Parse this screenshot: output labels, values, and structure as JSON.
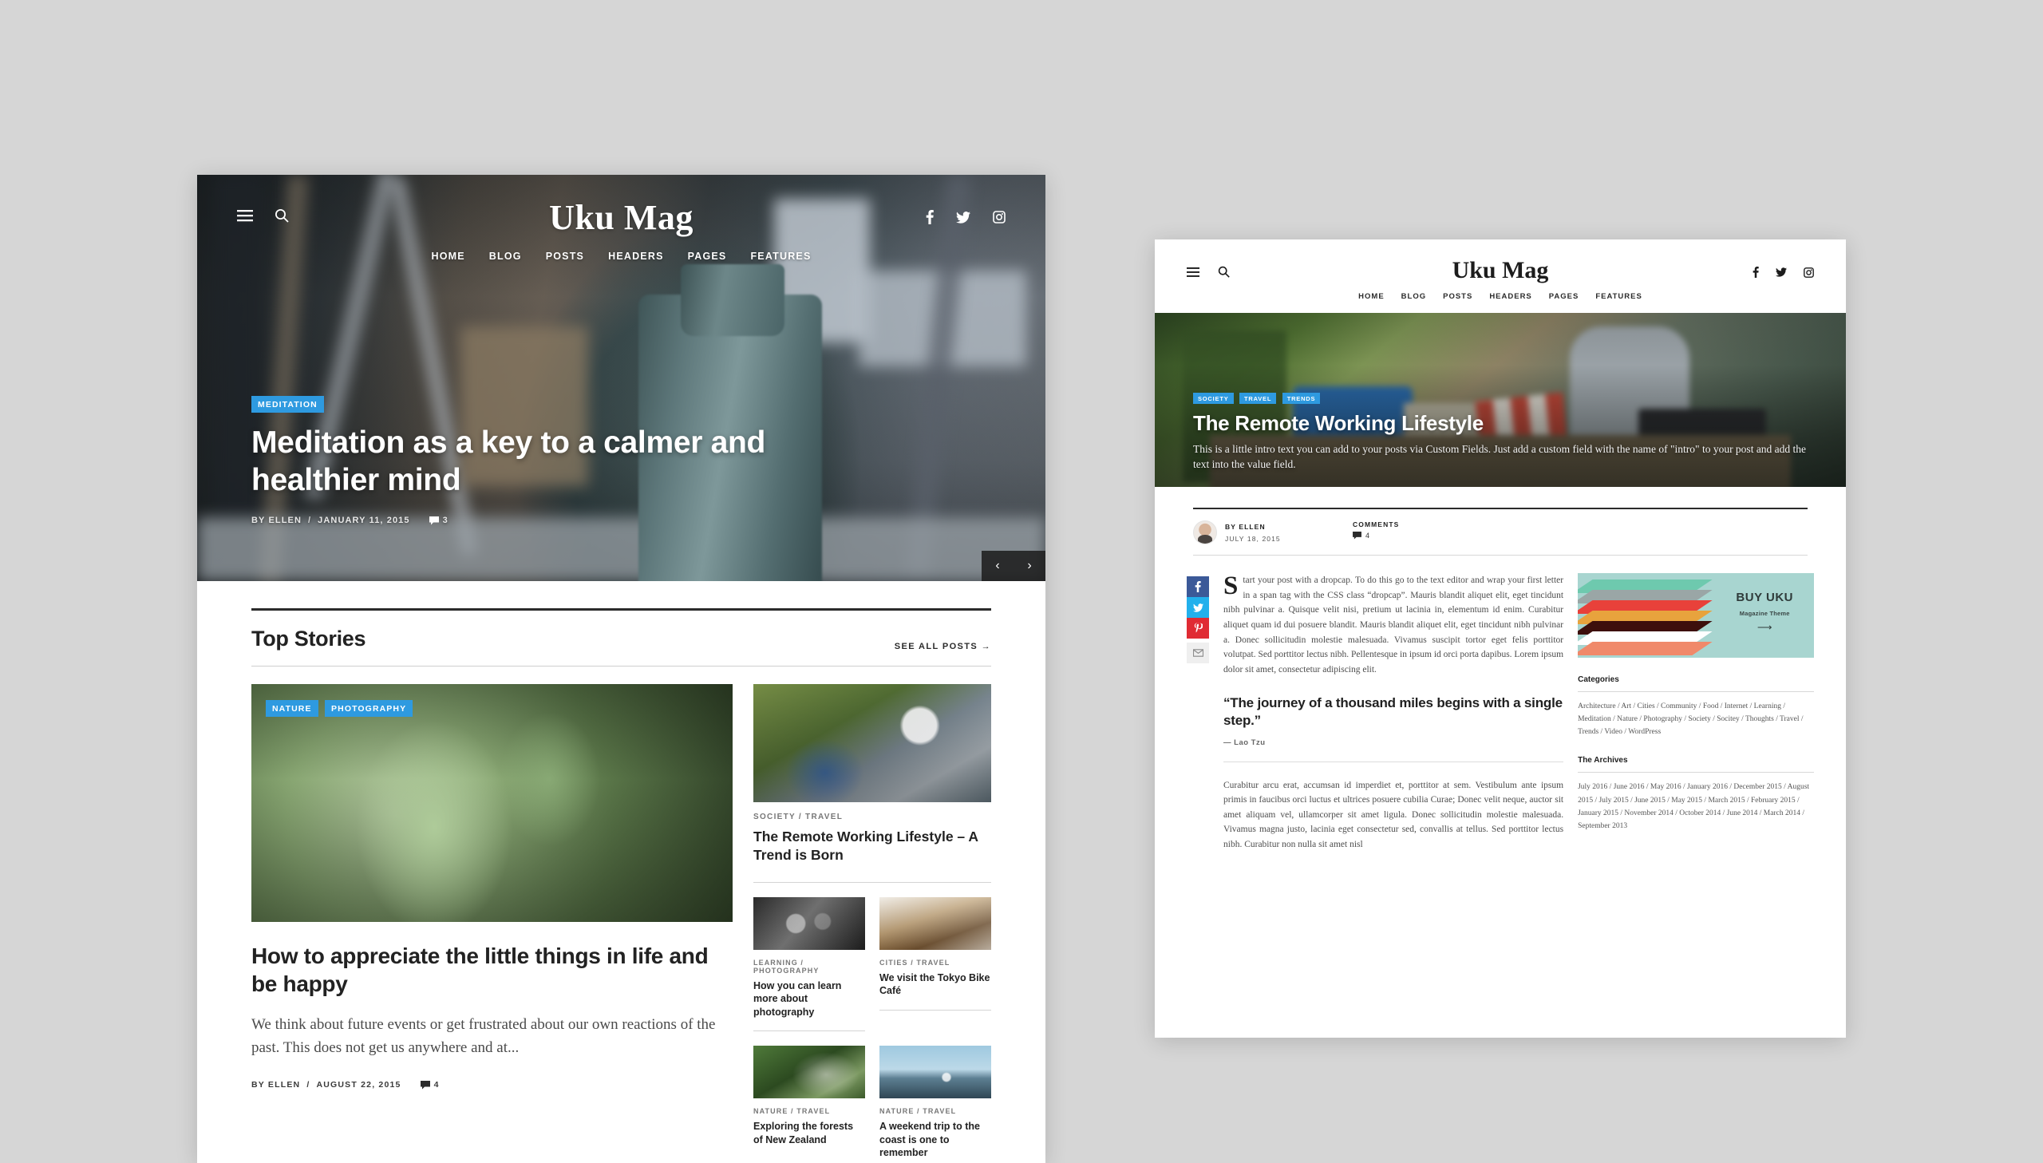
{
  "site": {
    "brand": "Uku Mag",
    "nav": [
      "HOME",
      "BLOG",
      "POSTS",
      "HEADERS",
      "PAGES",
      "FEATURES"
    ],
    "social": [
      "facebook-icon",
      "twitter-icon",
      "instagram-icon"
    ],
    "menu_icon": "hamburger-icon",
    "search_icon": "search-icon"
  },
  "window1": {
    "hero": {
      "badges": [
        "MEDITATION"
      ],
      "title": "Meditation as a key to a calmer and healthier mind",
      "author": "BY ELLEN",
      "separator": "/",
      "date": "JANUARY 11, 2015",
      "comments": "3",
      "prev_label": "‹",
      "next_label": "›"
    },
    "top_stories": {
      "heading": "Top Stories",
      "see_all": "SEE ALL POSTS →",
      "featured": {
        "badges": [
          "NATURE",
          "PHOTOGRAPHY"
        ],
        "title": "How to appreciate the little things in life and be happy",
        "excerpt": "We think about future events or get frustrated about our own reactions of the past. This does not get us anywhere and at...",
        "author": "BY ELLEN",
        "separator": "/",
        "date": "AUGUST 22, 2015",
        "comments": "4"
      },
      "side_featured": {
        "categories": "SOCIETY  /  TRAVEL",
        "title": "The Remote Working Lifestyle – A Trend is Born"
      },
      "mini_posts": [
        {
          "categories": "LEARNING  /  PHOTOGRAPHY",
          "title": "How you can learn more about photography"
        },
        {
          "categories": "CITIES  /  TRAVEL",
          "title": "We visit the Tokyo Bike Café"
        },
        {
          "categories": "NATURE  /  TRAVEL",
          "title": "Exploring the forests of New Zealand"
        },
        {
          "categories": "NATURE  /  TRAVEL",
          "title": "A weekend trip to the coast is one to remember"
        }
      ]
    }
  },
  "window2": {
    "hero": {
      "badges": [
        "SOCIETY",
        "TRAVEL",
        "TRENDS"
      ],
      "title": "The Remote Working Lifestyle",
      "intro": "This is a little intro text you can add to your posts via Custom Fields. Just add a custom field with the name of \"intro\" to your post and add the text into the value field."
    },
    "meta": {
      "author_label": "BY ELLEN",
      "date": "JULY 18, 2015",
      "comments_label": "COMMENTS",
      "comments_count": "4"
    },
    "share": [
      {
        "name": "facebook-share",
        "glyph": "f",
        "color": "#3b5998"
      },
      {
        "name": "twitter-share",
        "glyph": "t",
        "color": "#22b0ec"
      },
      {
        "name": "pinterest-share",
        "glyph": "P",
        "color": "#e02b33"
      },
      {
        "name": "email-share",
        "glyph": "✉",
        "color": "#efefef"
      }
    ],
    "article": {
      "dropcap": "S",
      "paragraph1": "tart your post with a dropcap. To do this go to the text editor and wrap your first letter in a span tag with the CSS class “dropcap”. Mauris blandit aliquet elit, eget tincidunt nibh pulvinar a. Quisque velit nisi, pretium ut lacinia in, elementum id enim. Curabitur aliquet quam id dui posuere blandit. Mauris blandit aliquet elit, eget tincidunt nibh pulvinar a. Donec sollicitudin molestie malesuada. Vivamus suscipit tortor eget felis porttitor volutpat. Sed porttitor lectus nibh. Pellentesque in ipsum id orci porta dapibus. Lorem ipsum dolor sit amet, consectetur adipiscing elit.",
      "quote": "“The journey of a thousand miles begins with a single step.”",
      "quote_author": "— Lao Tzu",
      "paragraph2": "Curabitur arcu erat, accumsan id imperdiet et, porttitor at sem. Vestibulum ante ipsum primis in faucibus orci luctus et ultrices posuere cubilia Curae; Donec velit neque, auctor sit amet aliquam vel, ullamcorper sit amet ligula. Donec sollicitudin molestie malesuada. Vivamus magna justo, lacinia eget consectetur sed, convallis at tellus. Sed porttitor lectus nibh. Curabitur non nulla sit amet nisl"
    },
    "sidebar": {
      "ad": {
        "title": "BUY UKU",
        "subtitle": "Magazine Theme",
        "arrow": "⟶",
        "bg": "#a8d5d0",
        "layer_colors": [
          "#6ec9ae",
          "#9aa6a6",
          "#e8413a",
          "#e8a33d",
          "#3d0f0c",
          "#f0896a",
          "#ffffff"
        ]
      },
      "categories": {
        "heading": "Categories",
        "items": "Architecture / Art / Cities / Community / Food / Internet / Learning / Meditation / Nature / Photography / Society / Socitey / Thoughts / Travel / Trends / Video / WordPress"
      },
      "archives": {
        "heading": "The Archives",
        "items": "July 2016 / June 2016 / May 2016 / January 2016 / December 2015 / August 2015 / July 2015 / June 2015 / May 2015 / March 2015 / February 2015 / January 2015 / November 2014 / October 2014 / June 2014 / March 2014 / September 2013"
      }
    }
  },
  "theme": {
    "badge_color": "#2e9ae0",
    "page_bg": "#d6d6d6"
  }
}
